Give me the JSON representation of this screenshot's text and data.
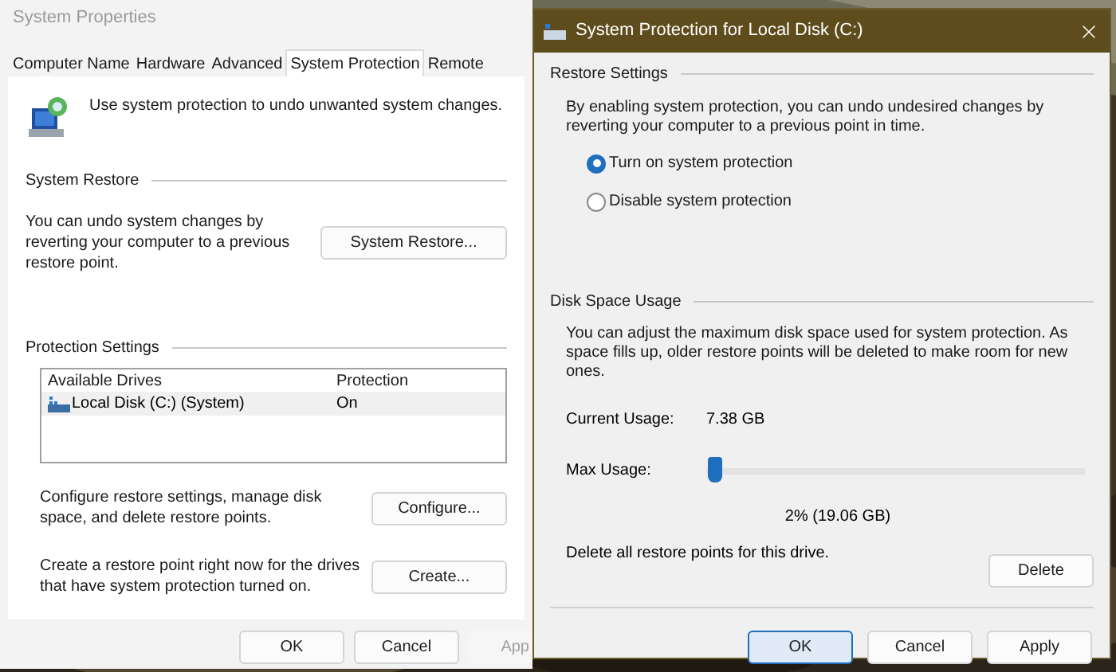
{
  "main_window": {
    "title": "System Properties",
    "tabs": [
      {
        "label": "Computer Name",
        "selected": false
      },
      {
        "label": "Hardware",
        "selected": false
      },
      {
        "label": "Advanced",
        "selected": false
      },
      {
        "label": "System Protection",
        "selected": true
      },
      {
        "label": "Remote",
        "selected": false
      }
    ],
    "intro": "Use system protection to undo unwanted system changes.",
    "system_restore": {
      "heading": "System Restore",
      "text": "You can undo system changes by reverting your computer to a previous restore point.",
      "button": "System Restore..."
    },
    "protection_settings": {
      "heading": "Protection Settings",
      "columns": [
        "Available Drives",
        "Protection"
      ],
      "rows": [
        {
          "drive": "Local Disk (C:) (System)",
          "protection": "On",
          "selected": true
        }
      ],
      "configure": {
        "text": "Configure restore settings, manage disk space, and delete restore points.",
        "button": "Configure..."
      },
      "create": {
        "text": "Create a restore point right now for the drives that have system protection turned on.",
        "button": "Create..."
      }
    },
    "buttons": [
      "OK",
      "Cancel",
      "App"
    ]
  },
  "dialog": {
    "title": "System Protection for Local Disk (C:)",
    "restore_settings": {
      "heading": "Restore Settings",
      "text": "By enabling system protection, you can undo undesired changes by reverting your computer to a previous point in time.",
      "options": [
        {
          "label": "Turn on system protection",
          "selected": true
        },
        {
          "label": "Disable system protection",
          "selected": false
        }
      ]
    },
    "disk_space": {
      "heading": "Disk Space Usage",
      "text": "You can adjust the maximum disk space used for system protection. As space fills up, older restore points will be deleted to make room for new ones.",
      "current_label": "Current Usage:",
      "current_value": "7.38 GB",
      "max_label": "Max Usage:",
      "level": 0.02,
      "reading": "2% (19.06 GB)",
      "delete_text": "Delete all restore points for this drive.",
      "delete_button": "Delete"
    },
    "buttons": [
      {
        "label": "OK",
        "selected": true
      },
      {
        "label": "Cancel",
        "selected": false
      },
      {
        "label": "Apply",
        "selected": false
      }
    ]
  }
}
